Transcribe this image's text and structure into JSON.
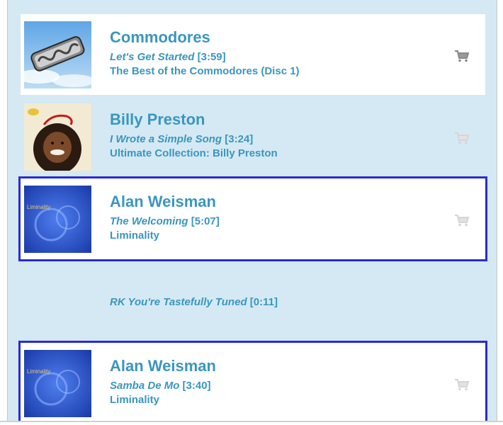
{
  "playlist": [
    {
      "artist": "Commodores",
      "title": "Let's Get Started",
      "duration": "[3:59]",
      "album": "The Best of the Commodores (Disc 1)",
      "artwork": "commodores-album-art",
      "cart_icon": "shopping-cart-icon"
    },
    {
      "artist": "Billy Preston",
      "title": "I Wrote a Simple Song",
      "duration": "[3:24]",
      "album": "Ultimate Collection: Billy Preston",
      "artwork": "billy-preston-album-art",
      "cart_icon": "shopping-cart-icon"
    },
    {
      "artist": "Alan Weisman",
      "title": "The Welcoming",
      "duration": "[5:07]",
      "album": "Liminality",
      "artwork": "liminality-album-art",
      "art_text": "Liminality",
      "cart_icon": "shopping-cart-icon"
    },
    {
      "artist": "Alan Weisman",
      "title": "Samba De Mo",
      "duration": "[3:40]",
      "album": "Liminality",
      "artwork": "liminality-album-art",
      "art_text": "Liminality",
      "cart_icon": "shopping-cart-icon"
    }
  ],
  "spot": {
    "title": "RK You're Tastefully Tuned",
    "duration": "[0:11]"
  },
  "colors": {
    "text": "#3a96bf",
    "background": "#d4e9f3",
    "selection": "#2a2ad6"
  }
}
